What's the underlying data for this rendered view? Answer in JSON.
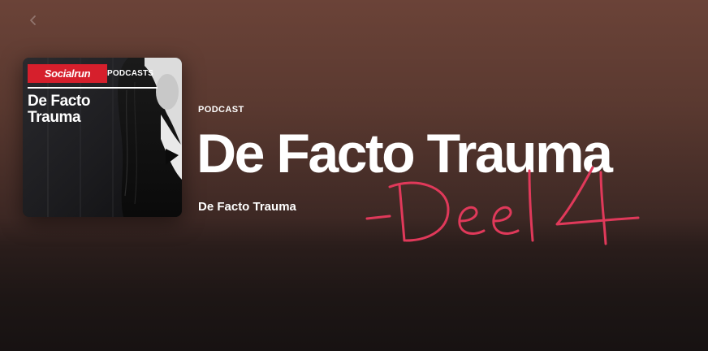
{
  "header": {
    "type_label": "PODCAST",
    "title": "De Facto Trauma",
    "publisher": "De Facto Trauma",
    "background_color": "#5a3930"
  },
  "cover": {
    "brand_name": "Socialrun",
    "brand_tag": "PODCASTS",
    "title_line1": "De Facto",
    "title_line2": "Trauma",
    "brand_color": "#d61f2c"
  },
  "annotation": {
    "text": "-Deel 4-",
    "color": "#e0395a"
  },
  "icons": {
    "back": "chevron-left-icon"
  }
}
